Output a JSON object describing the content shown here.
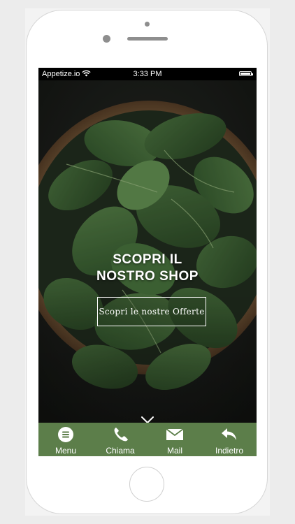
{
  "status_bar": {
    "carrier": "Appetize.io",
    "time": "3:33 PM"
  },
  "hero": {
    "title_line1": "SCOPRI IL",
    "title_line2": "NOSTRO SHOP",
    "cta_label": "Scopri le nostre Offerte",
    "scroll_icon": "chevron-down-icon"
  },
  "tabbar": {
    "items": [
      {
        "label": "Menu",
        "icon": "menu-icon"
      },
      {
        "label": "Chiama",
        "icon": "phone-icon"
      },
      {
        "label": "Mail",
        "icon": "mail-icon"
      },
      {
        "label": "Indietro",
        "icon": "back-arrow-icon"
      }
    ]
  },
  "colors": {
    "tabbar": "#5c7e4a",
    "status_bar": "#000000",
    "text": "#ffffff"
  }
}
